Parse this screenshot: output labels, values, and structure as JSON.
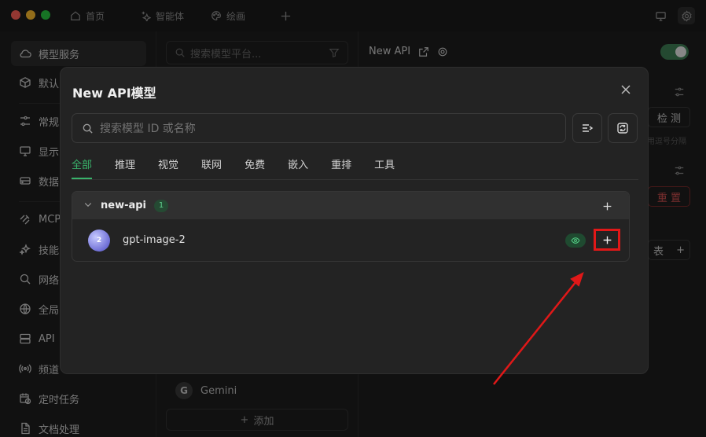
{
  "titlebar": {
    "tabs": [
      {
        "label": "首页",
        "icon": "home-icon"
      },
      {
        "label": "智能体",
        "icon": "sparkle-icon"
      },
      {
        "label": "绘画",
        "icon": "palette-icon"
      }
    ]
  },
  "sidebar": {
    "items": [
      {
        "label": "模型服务",
        "icon": "cloud-icon"
      },
      {
        "label": "默认",
        "icon": "cube-icon"
      },
      {
        "label": "常规",
        "icon": "sliders-icon"
      },
      {
        "label": "显示",
        "icon": "monitor-icon"
      },
      {
        "label": "数据",
        "icon": "database-icon"
      },
      {
        "label": "MCP",
        "icon": "mcp-icon"
      },
      {
        "label": "技能",
        "icon": "sparkles-icon"
      },
      {
        "label": "网络",
        "icon": "search-icon"
      },
      {
        "label": "全局",
        "icon": "globe-icon"
      },
      {
        "label": "API",
        "icon": "server-icon"
      },
      {
        "label": "频道",
        "icon": "radio-icon"
      },
      {
        "label": "定时任务",
        "icon": "calendar-clock-icon"
      },
      {
        "label": "文档处理",
        "icon": "document-icon"
      }
    ]
  },
  "providers": {
    "search_placeholder": "搜索模型平台...",
    "visible_item": "Gemini",
    "visible_item_logo": "G",
    "add_label": "添加"
  },
  "right_panel": {
    "title": "New API",
    "check_label": "检 测",
    "hint": "用逗号分隔",
    "reset_label": "重 置",
    "list_label": "表"
  },
  "modal": {
    "title": "New API模型",
    "search_placeholder": "搜索模型 ID 或名称",
    "tabs": [
      "全部",
      "推理",
      "视觉",
      "联网",
      "免费",
      "嵌入",
      "重排",
      "工具"
    ],
    "active_tab": "全部",
    "group": {
      "name": "new-api",
      "count": "1",
      "models": [
        {
          "name": "gpt-image-2",
          "avatar_text": "2",
          "capability": "vision"
        }
      ]
    }
  },
  "colors": {
    "accent_green": "#39b36b",
    "highlight_red": "#e01818",
    "background": "#1e1e1e",
    "modal_bg": "#232323"
  }
}
